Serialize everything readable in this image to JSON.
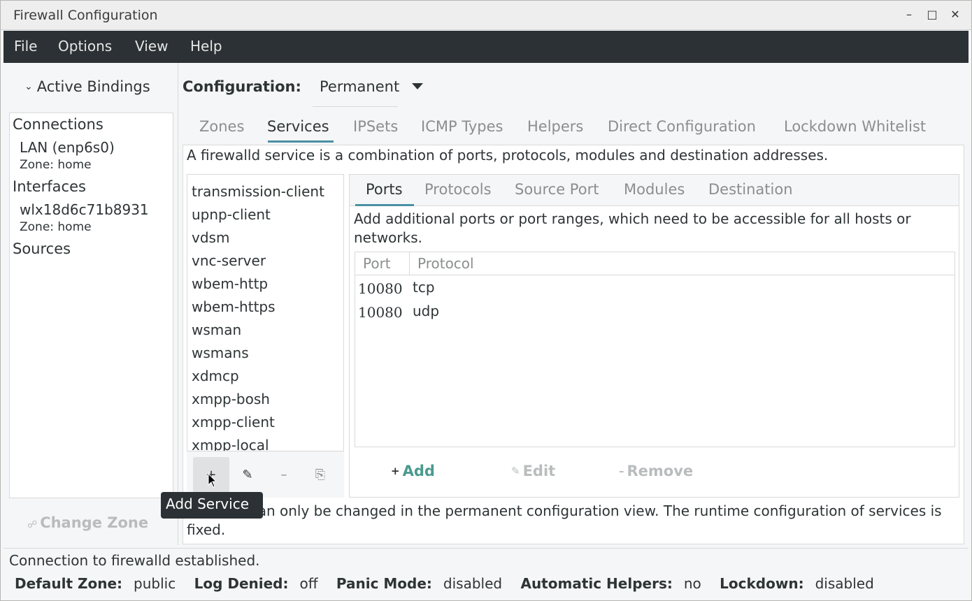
{
  "window": {
    "title": "Firewall Configuration"
  },
  "menubar": {
    "items": [
      "File",
      "Options",
      "View",
      "Help"
    ]
  },
  "left": {
    "active_bindings_label": "Active Bindings",
    "connections_heading": "Connections",
    "connection_name": "LAN (enp6s0)",
    "connection_zone": "Zone: home",
    "interfaces_heading": "Interfaces",
    "interface_name": "wlx18d6c71b8931",
    "interface_zone": "Zone: home",
    "sources_heading": "Sources",
    "change_zone_label": "Change Zone"
  },
  "config": {
    "label": "Configuration:",
    "value": "Permanent"
  },
  "main_tabs": [
    "Zones",
    "Services",
    "IPSets",
    "ICMP Types",
    "Helpers",
    "Direct Configuration",
    "Lockdown Whitelist"
  ],
  "services": {
    "description": "A firewalld service is a combination of ports, protocols, modules and destination addresses.",
    "list": [
      "transmission-client",
      "upnp-client",
      "vdsm",
      "vnc-server",
      "wbem-http",
      "wbem-https",
      "wsman",
      "wsmans",
      "xdmcp",
      "xmpp-bosh",
      "xmpp-client",
      "xmpp-local"
    ],
    "tooltip": "Add Service",
    "note": "Services can only be changed in the permanent configuration view. The runtime configuration of services is fixed."
  },
  "detail": {
    "tabs": [
      "Ports",
      "Protocols",
      "Source Port",
      "Modules",
      "Destination"
    ],
    "ports_description": "Add additional ports or port ranges, which need to be accessible for all hosts or networks.",
    "columns": [
      "Port",
      "Protocol"
    ],
    "rows": [
      {
        "port": "10080",
        "protocol": "tcp"
      },
      {
        "port": "10080",
        "protocol": "udp"
      }
    ],
    "add_label": "Add",
    "edit_label": "Edit",
    "remove_label": "Remove"
  },
  "status": {
    "message": "Connection to firewalld established.",
    "default_zone_label": "Default Zone:",
    "default_zone": "public",
    "log_denied_label": "Log Denied:",
    "log_denied": "off",
    "panic_mode_label": "Panic Mode:",
    "panic_mode": "disabled",
    "auto_helpers_label": "Automatic Helpers:",
    "auto_helpers": "no",
    "lockdown_label": "Lockdown:",
    "lockdown": "disabled"
  },
  "colors": {
    "menubar_bg": "#2b3134",
    "accent": "#4a90a4",
    "disabled_text": "#b9bcbd"
  }
}
